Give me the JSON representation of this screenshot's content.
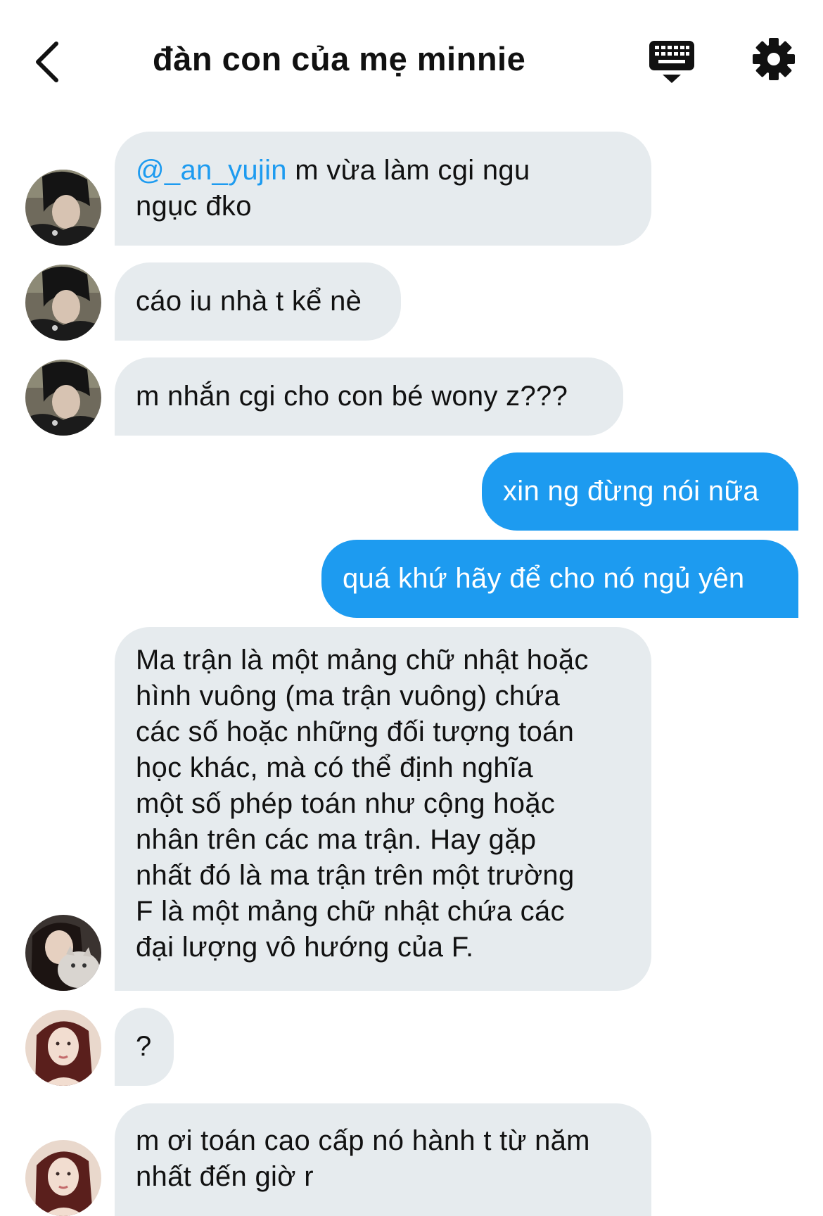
{
  "header": {
    "title": "đàn con của mẹ minnie",
    "back_icon": "chevron-left-icon",
    "keyboard_icon": "keyboard-icon",
    "settings_icon": "gear-icon"
  },
  "messages": [
    {
      "direction": "in",
      "mention": "@_an_yujin",
      "text": " m vừa làm cgi ngu\nngục đko"
    },
    {
      "direction": "in",
      "text": "cáo iu nhà t kể nè"
    },
    {
      "direction": "in",
      "text": "m nhắn cgi cho con bé wony z???"
    },
    {
      "direction": "out",
      "text": "xin ng đừng nói nữa"
    },
    {
      "direction": "out",
      "text": "quá khứ hãy để cho nó ngủ yên"
    },
    {
      "direction": "in",
      "text": "Ma trận là một mảng chữ nhật hoặc\nhình vuông (ma trận vuông) chứa\ncác số hoặc những đối tượng toán\nhọc khác, mà có thể định nghĩa\nmột số phép toán như cộng hoặc\nnhân trên các ma trận. Hay gặp\nnhất đó là ma trận trên một trường\nF là một mảng chữ nhật chứa các\nđại lượng vô hướng của F."
    },
    {
      "direction": "in",
      "text": "?"
    },
    {
      "direction": "in",
      "text": "m ơi toán cao cấp nó hành t từ năm\nnhất đến giờ r"
    }
  ],
  "colors": {
    "incoming_bubble": "#e6ebee",
    "outgoing_bubble": "#1d9bf0",
    "mention": "#1d9bf0"
  }
}
